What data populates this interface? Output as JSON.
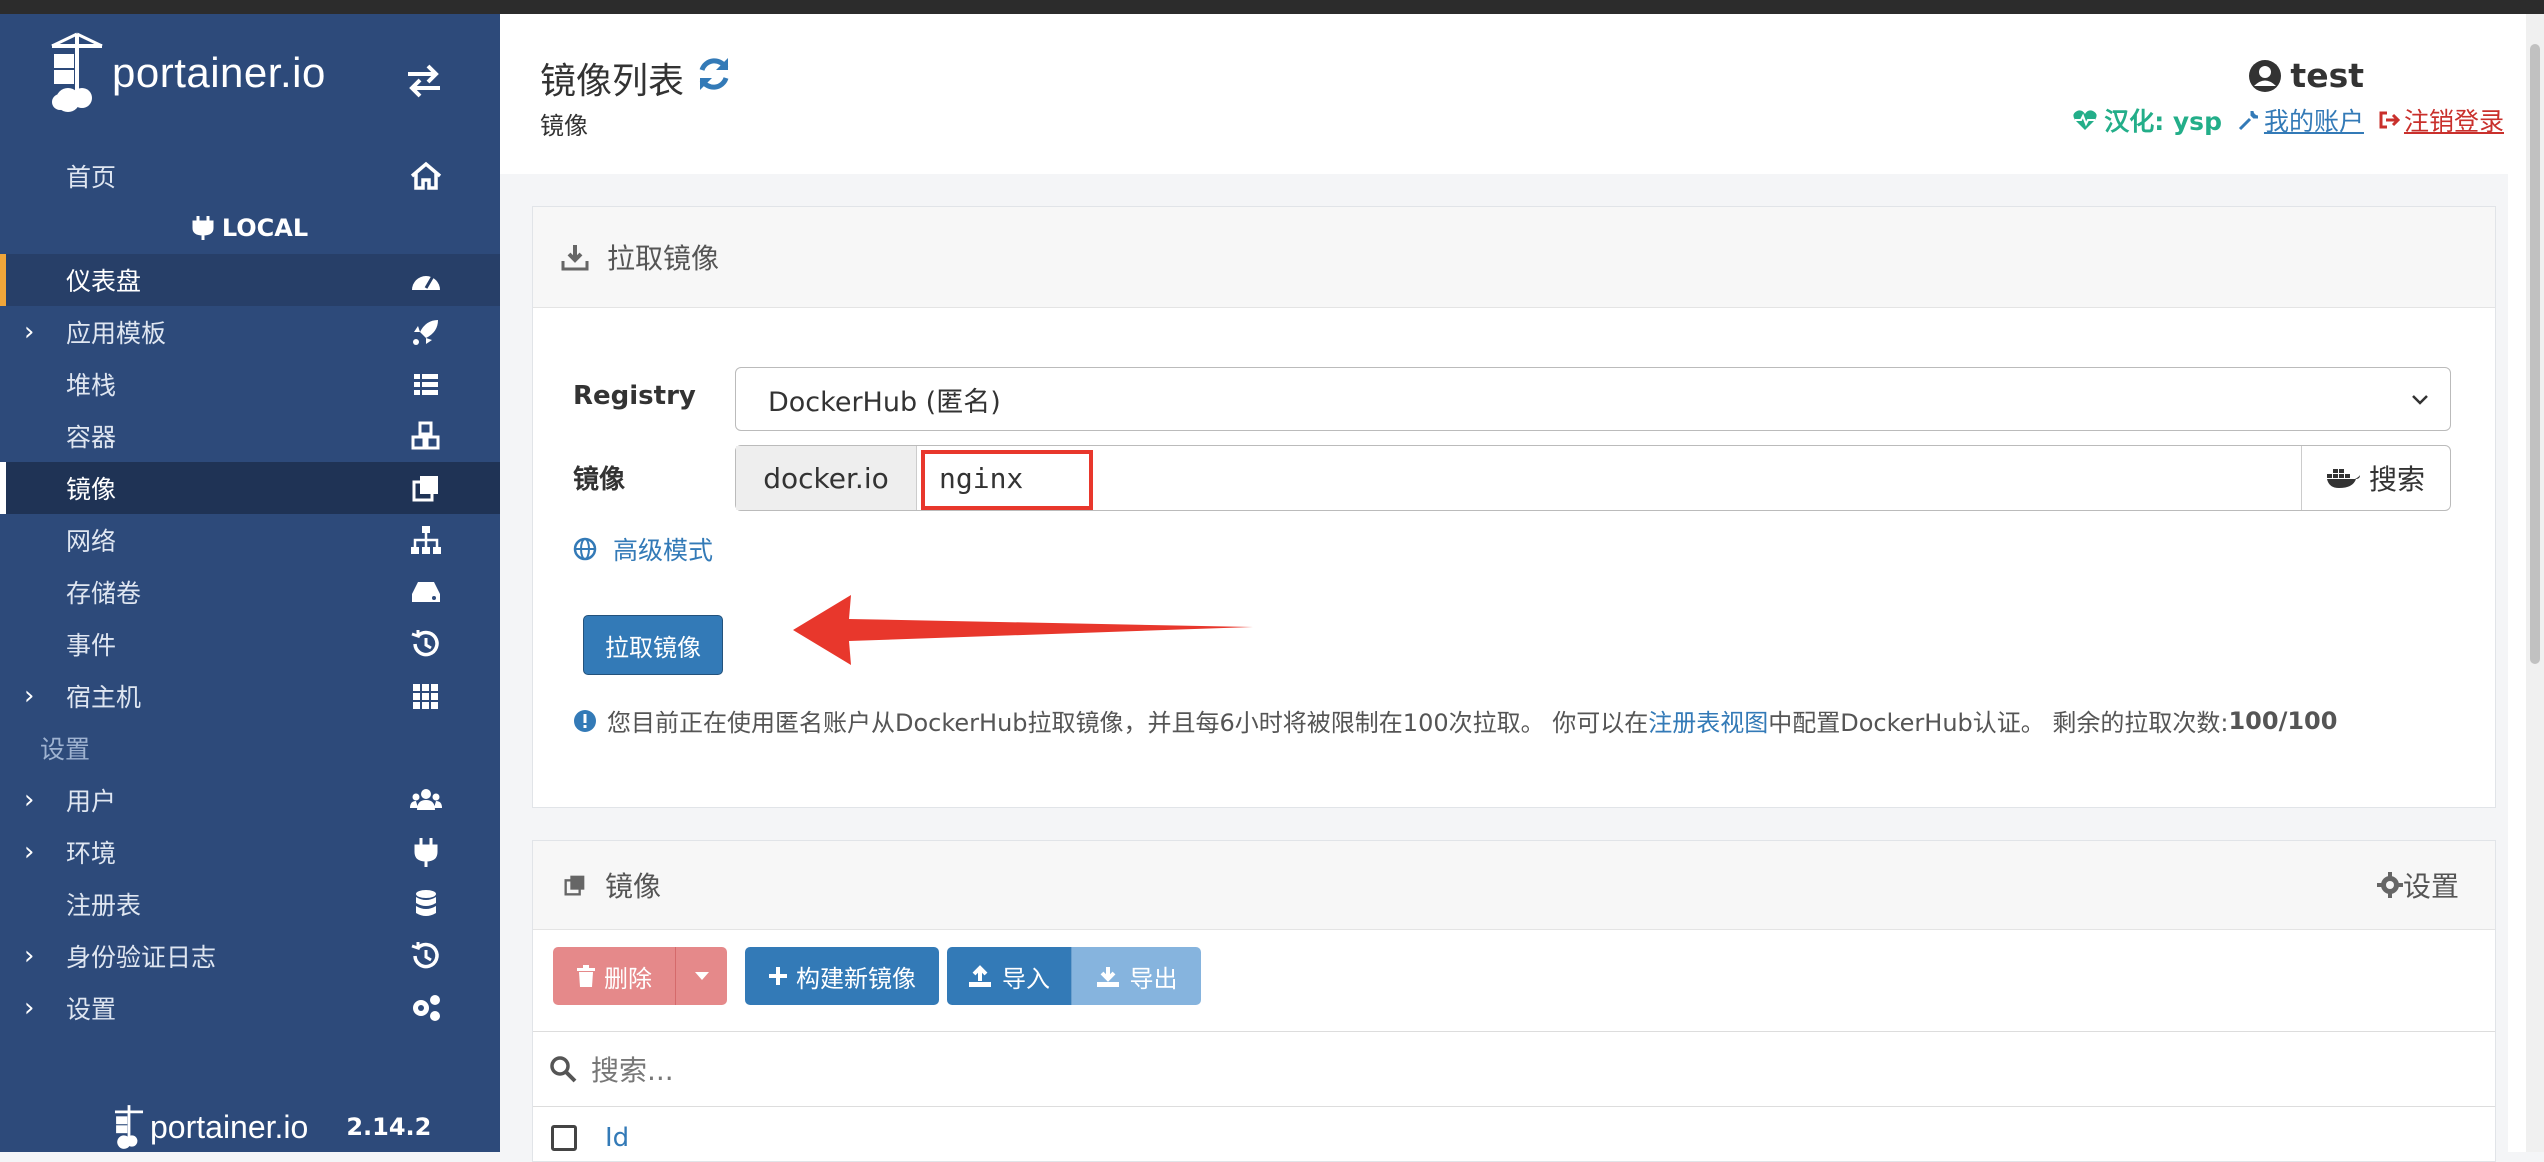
{
  "colors": {
    "sidebar": "#2d4a7a",
    "accent": "#337ab7",
    "danger": "#d9534f",
    "success": "#23ae89",
    "highlight": "#e8372c"
  },
  "brand": {
    "name": "portainer.io",
    "version": "2.14.2"
  },
  "sidebar": {
    "home": "首页",
    "env": "LOCAL",
    "items": [
      {
        "label": "仪表盘",
        "icon": "dashboard-icon",
        "chevron": false
      },
      {
        "label": "应用模板",
        "icon": "rocket-icon",
        "chevron": true
      },
      {
        "label": "堆栈",
        "icon": "list-icon",
        "chevron": false
      },
      {
        "label": "容器",
        "icon": "cubes-icon",
        "chevron": false
      },
      {
        "label": "镜像",
        "icon": "clone-icon",
        "chevron": false
      },
      {
        "label": "网络",
        "icon": "sitemap-icon",
        "chevron": false
      },
      {
        "label": "存储卷",
        "icon": "hdd-icon",
        "chevron": false
      },
      {
        "label": "事件",
        "icon": "history-icon",
        "chevron": false
      },
      {
        "label": "宿主机",
        "icon": "grid-icon",
        "chevron": true
      }
    ],
    "settings_section": "设置",
    "settings_items": [
      {
        "label": "用户",
        "icon": "users-icon",
        "chevron": true
      },
      {
        "label": "环境",
        "icon": "plug-icon",
        "chevron": true
      },
      {
        "label": "注册表",
        "icon": "database-icon",
        "chevron": false
      },
      {
        "label": "身份验证日志",
        "icon": "history-icon",
        "chevron": true
      },
      {
        "label": "设置",
        "icon": "cogs-icon",
        "chevron": true
      }
    ]
  },
  "header": {
    "title": "镜像列表",
    "breadcrumb": "镜像",
    "user": "test",
    "localization": "汉化: ysp",
    "my_account": "我的账户",
    "logout": "注销登录"
  },
  "pull_panel": {
    "title": "拉取镜像",
    "registry_label": "Registry",
    "registry_value": "DockerHub (匿名)",
    "image_label": "镜像",
    "registry_prefix": "docker.io",
    "image_value": "nginx",
    "search_button": "搜索",
    "advanced_mode": "高级模式",
    "pull_button": "拉取镜像",
    "info_prefix": "您目前正在使用匿名账户从DockerHub拉取镜像，并且每6小时将被限制在100次拉取。 你可以在 ",
    "info_link": "注册表视图",
    "info_middle": "中配置DockerHub认证。 剩余的拉取次数: ",
    "info_count": "100/100"
  },
  "images_panel": {
    "title": "镜像",
    "settings": "设置",
    "delete": "删除",
    "build": "构建新镜像",
    "import": "导入",
    "export": "导出",
    "search_placeholder": "搜索...",
    "col_id": "Id"
  }
}
